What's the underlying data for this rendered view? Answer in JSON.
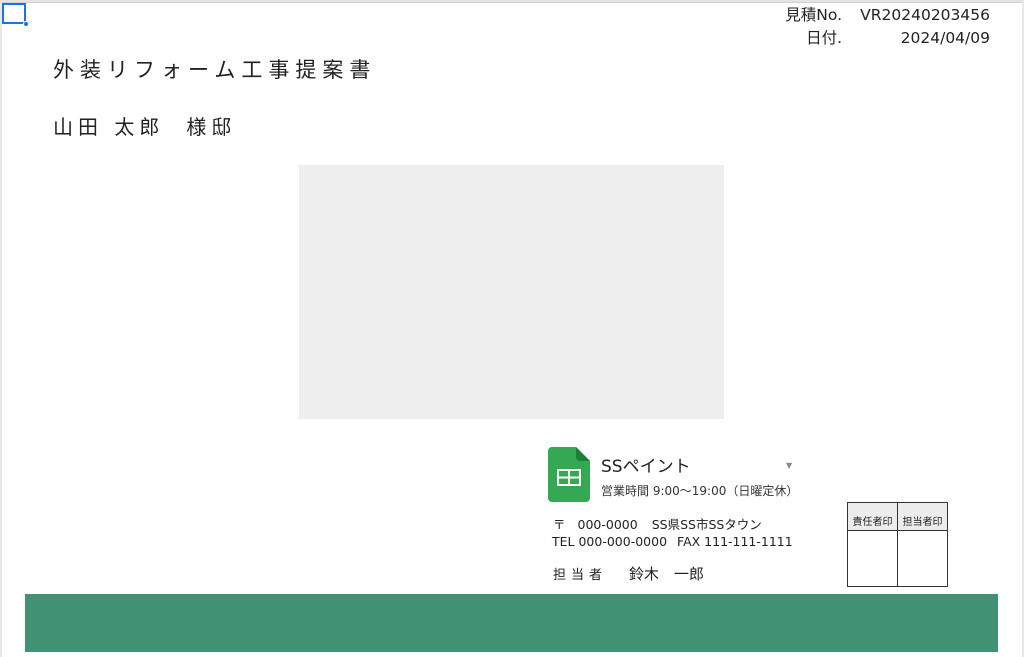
{
  "estimate": {
    "number_label": "見積No.",
    "number_value": "VR20240203456",
    "date_label": "日付.",
    "date_value": "2024/04/09"
  },
  "document": {
    "title": "外装リフォーム工事提案書",
    "customer_name": "山田 太郎",
    "customer_honorific": "様邸"
  },
  "company": {
    "icon": "google-sheets-icon",
    "name": "SSペイント",
    "hours": "営業時間 9:00〜19:00（日曜定休）",
    "postal_mark": "〒",
    "zip": "000-0000",
    "address": "SS県SS市SSタウン",
    "tel": "TEL 000-000-0000",
    "fax": "FAX 111-111-1111",
    "rep_label": "担当者",
    "rep_name": "鈴木　一郎"
  },
  "stamps": {
    "headers": [
      "責任者印",
      "担当者印"
    ]
  },
  "colors": {
    "footer": "#409273",
    "sheets_green": "#34A853",
    "selection": "#1a73e8",
    "photo_placeholder": "#eeeeee"
  }
}
